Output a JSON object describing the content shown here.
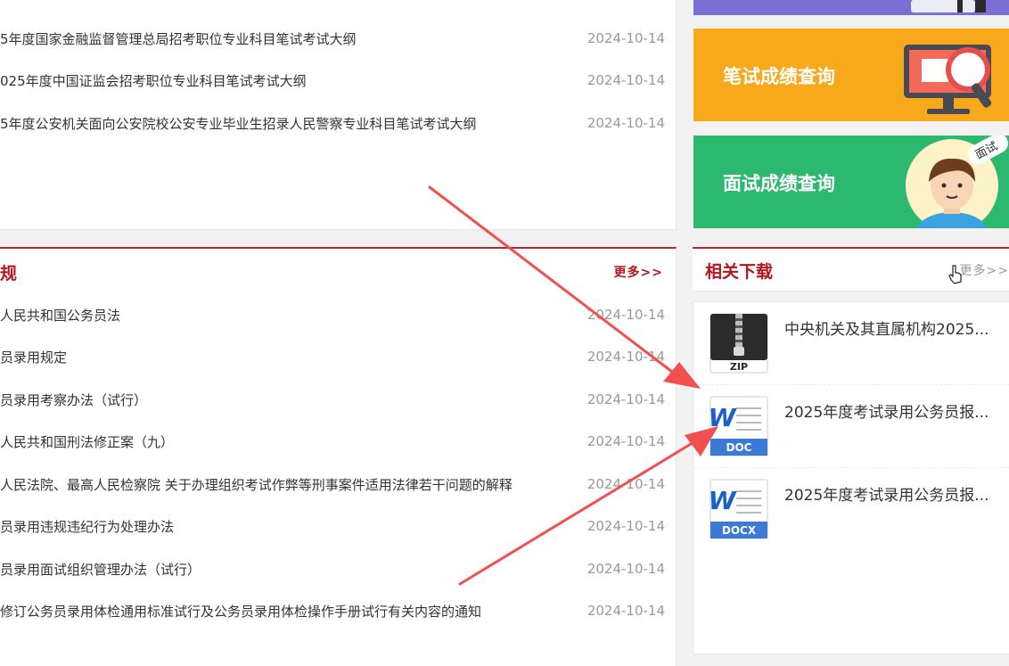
{
  "top_news": {
    "rows": [
      {
        "title": "5年度国家金融监督管理总局招考职位专业科目笔试考试大纲",
        "date": "2024-10-14"
      },
      {
        "title": "025年度中国证监会招考职位专业科目笔试考试大纲",
        "date": "2024-10-14"
      },
      {
        "title": "5年度公安机关面向公安院校公安专业毕业生招录人民警察专业科目笔试考试大纲",
        "date": "2024-10-14"
      }
    ]
  },
  "laws": {
    "title": "规",
    "more": "更多>>",
    "rows": [
      {
        "title": "人民共和国公务员法",
        "date": "2024-10-14"
      },
      {
        "title": "员录用规定",
        "date": "2024-10-14"
      },
      {
        "title": "员录用考察办法（试行）",
        "date": "2024-10-14"
      },
      {
        "title": "人民共和国刑法修正案（九）",
        "date": "2024-10-14"
      },
      {
        "title": "人民法院、最高人民检察院 关于办理组织考试作弊等刑事案件适用法律若干问题的解释",
        "date": "2024-10-14"
      },
      {
        "title": "员录用违规违纪行为处理办法",
        "date": "2024-10-14"
      },
      {
        "title": "员录用面试组织管理办法（试行）",
        "date": "2024-10-14"
      },
      {
        "title": "修订公务员录用体检通用标准试行及公务员录用体检操作手册试行有关内容的通知",
        "date": "2024-10-14"
      }
    ]
  },
  "banners": {
    "written_score": "笔试成绩查询",
    "interview_score": "面试成绩查询",
    "interview_tag": "面试",
    "colors": {
      "purple": "#7b6fd6",
      "orange": "#f7a81b",
      "green": "#2db870"
    }
  },
  "downloads": {
    "title": "相关下载",
    "more": "更多>>",
    "items": [
      {
        "name": "中央机关及其直属机构2025...",
        "icon": "zip-file-icon",
        "ext": "ZIP"
      },
      {
        "name": "2025年度考试录用公务员报...",
        "icon": "doc-file-icon",
        "ext": "DOC"
      },
      {
        "name": "2025年度考试录用公务员报...",
        "icon": "docx-file-icon",
        "ext": "DOCX"
      }
    ]
  },
  "accent_color": "#c4242b",
  "annotation_color": "#f0514f"
}
